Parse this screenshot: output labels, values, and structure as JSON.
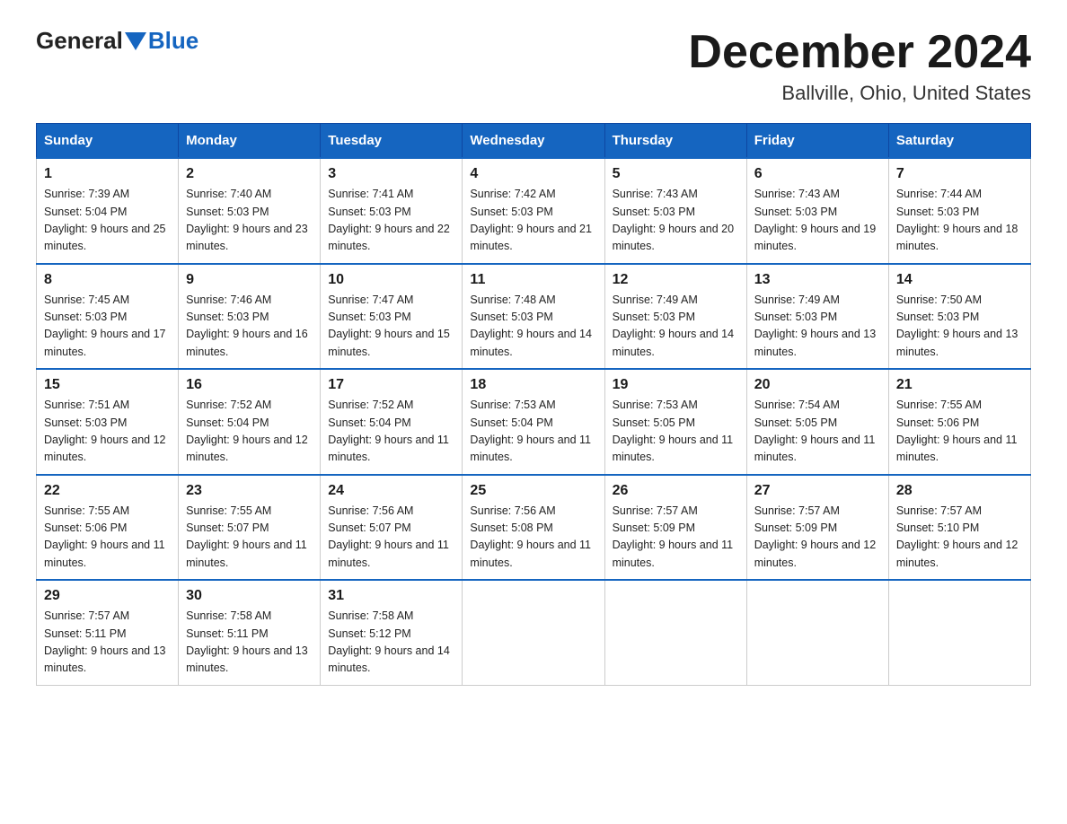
{
  "header": {
    "logo_general": "General",
    "logo_blue": "Blue",
    "title": "December 2024",
    "subtitle": "Ballville, Ohio, United States"
  },
  "days_of_week": [
    "Sunday",
    "Monday",
    "Tuesday",
    "Wednesday",
    "Thursday",
    "Friday",
    "Saturday"
  ],
  "weeks": [
    [
      {
        "num": "1",
        "sunrise": "7:39 AM",
        "sunset": "5:04 PM",
        "daylight": "9 hours and 25 minutes."
      },
      {
        "num": "2",
        "sunrise": "7:40 AM",
        "sunset": "5:03 PM",
        "daylight": "9 hours and 23 minutes."
      },
      {
        "num": "3",
        "sunrise": "7:41 AM",
        "sunset": "5:03 PM",
        "daylight": "9 hours and 22 minutes."
      },
      {
        "num": "4",
        "sunrise": "7:42 AM",
        "sunset": "5:03 PM",
        "daylight": "9 hours and 21 minutes."
      },
      {
        "num": "5",
        "sunrise": "7:43 AM",
        "sunset": "5:03 PM",
        "daylight": "9 hours and 20 minutes."
      },
      {
        "num": "6",
        "sunrise": "7:43 AM",
        "sunset": "5:03 PM",
        "daylight": "9 hours and 19 minutes."
      },
      {
        "num": "7",
        "sunrise": "7:44 AM",
        "sunset": "5:03 PM",
        "daylight": "9 hours and 18 minutes."
      }
    ],
    [
      {
        "num": "8",
        "sunrise": "7:45 AM",
        "sunset": "5:03 PM",
        "daylight": "9 hours and 17 minutes."
      },
      {
        "num": "9",
        "sunrise": "7:46 AM",
        "sunset": "5:03 PM",
        "daylight": "9 hours and 16 minutes."
      },
      {
        "num": "10",
        "sunrise": "7:47 AM",
        "sunset": "5:03 PM",
        "daylight": "9 hours and 15 minutes."
      },
      {
        "num": "11",
        "sunrise": "7:48 AM",
        "sunset": "5:03 PM",
        "daylight": "9 hours and 14 minutes."
      },
      {
        "num": "12",
        "sunrise": "7:49 AM",
        "sunset": "5:03 PM",
        "daylight": "9 hours and 14 minutes."
      },
      {
        "num": "13",
        "sunrise": "7:49 AM",
        "sunset": "5:03 PM",
        "daylight": "9 hours and 13 minutes."
      },
      {
        "num": "14",
        "sunrise": "7:50 AM",
        "sunset": "5:03 PM",
        "daylight": "9 hours and 13 minutes."
      }
    ],
    [
      {
        "num": "15",
        "sunrise": "7:51 AM",
        "sunset": "5:03 PM",
        "daylight": "9 hours and 12 minutes."
      },
      {
        "num": "16",
        "sunrise": "7:52 AM",
        "sunset": "5:04 PM",
        "daylight": "9 hours and 12 minutes."
      },
      {
        "num": "17",
        "sunrise": "7:52 AM",
        "sunset": "5:04 PM",
        "daylight": "9 hours and 11 minutes."
      },
      {
        "num": "18",
        "sunrise": "7:53 AM",
        "sunset": "5:04 PM",
        "daylight": "9 hours and 11 minutes."
      },
      {
        "num": "19",
        "sunrise": "7:53 AM",
        "sunset": "5:05 PM",
        "daylight": "9 hours and 11 minutes."
      },
      {
        "num": "20",
        "sunrise": "7:54 AM",
        "sunset": "5:05 PM",
        "daylight": "9 hours and 11 minutes."
      },
      {
        "num": "21",
        "sunrise": "7:55 AM",
        "sunset": "5:06 PM",
        "daylight": "9 hours and 11 minutes."
      }
    ],
    [
      {
        "num": "22",
        "sunrise": "7:55 AM",
        "sunset": "5:06 PM",
        "daylight": "9 hours and 11 minutes."
      },
      {
        "num": "23",
        "sunrise": "7:55 AM",
        "sunset": "5:07 PM",
        "daylight": "9 hours and 11 minutes."
      },
      {
        "num": "24",
        "sunrise": "7:56 AM",
        "sunset": "5:07 PM",
        "daylight": "9 hours and 11 minutes."
      },
      {
        "num": "25",
        "sunrise": "7:56 AM",
        "sunset": "5:08 PM",
        "daylight": "9 hours and 11 minutes."
      },
      {
        "num": "26",
        "sunrise": "7:57 AM",
        "sunset": "5:09 PM",
        "daylight": "9 hours and 11 minutes."
      },
      {
        "num": "27",
        "sunrise": "7:57 AM",
        "sunset": "5:09 PM",
        "daylight": "9 hours and 12 minutes."
      },
      {
        "num": "28",
        "sunrise": "7:57 AM",
        "sunset": "5:10 PM",
        "daylight": "9 hours and 12 minutes."
      }
    ],
    [
      {
        "num": "29",
        "sunrise": "7:57 AM",
        "sunset": "5:11 PM",
        "daylight": "9 hours and 13 minutes."
      },
      {
        "num": "30",
        "sunrise": "7:58 AM",
        "sunset": "5:11 PM",
        "daylight": "9 hours and 13 minutes."
      },
      {
        "num": "31",
        "sunrise": "7:58 AM",
        "sunset": "5:12 PM",
        "daylight": "9 hours and 14 minutes."
      },
      null,
      null,
      null,
      null
    ]
  ]
}
